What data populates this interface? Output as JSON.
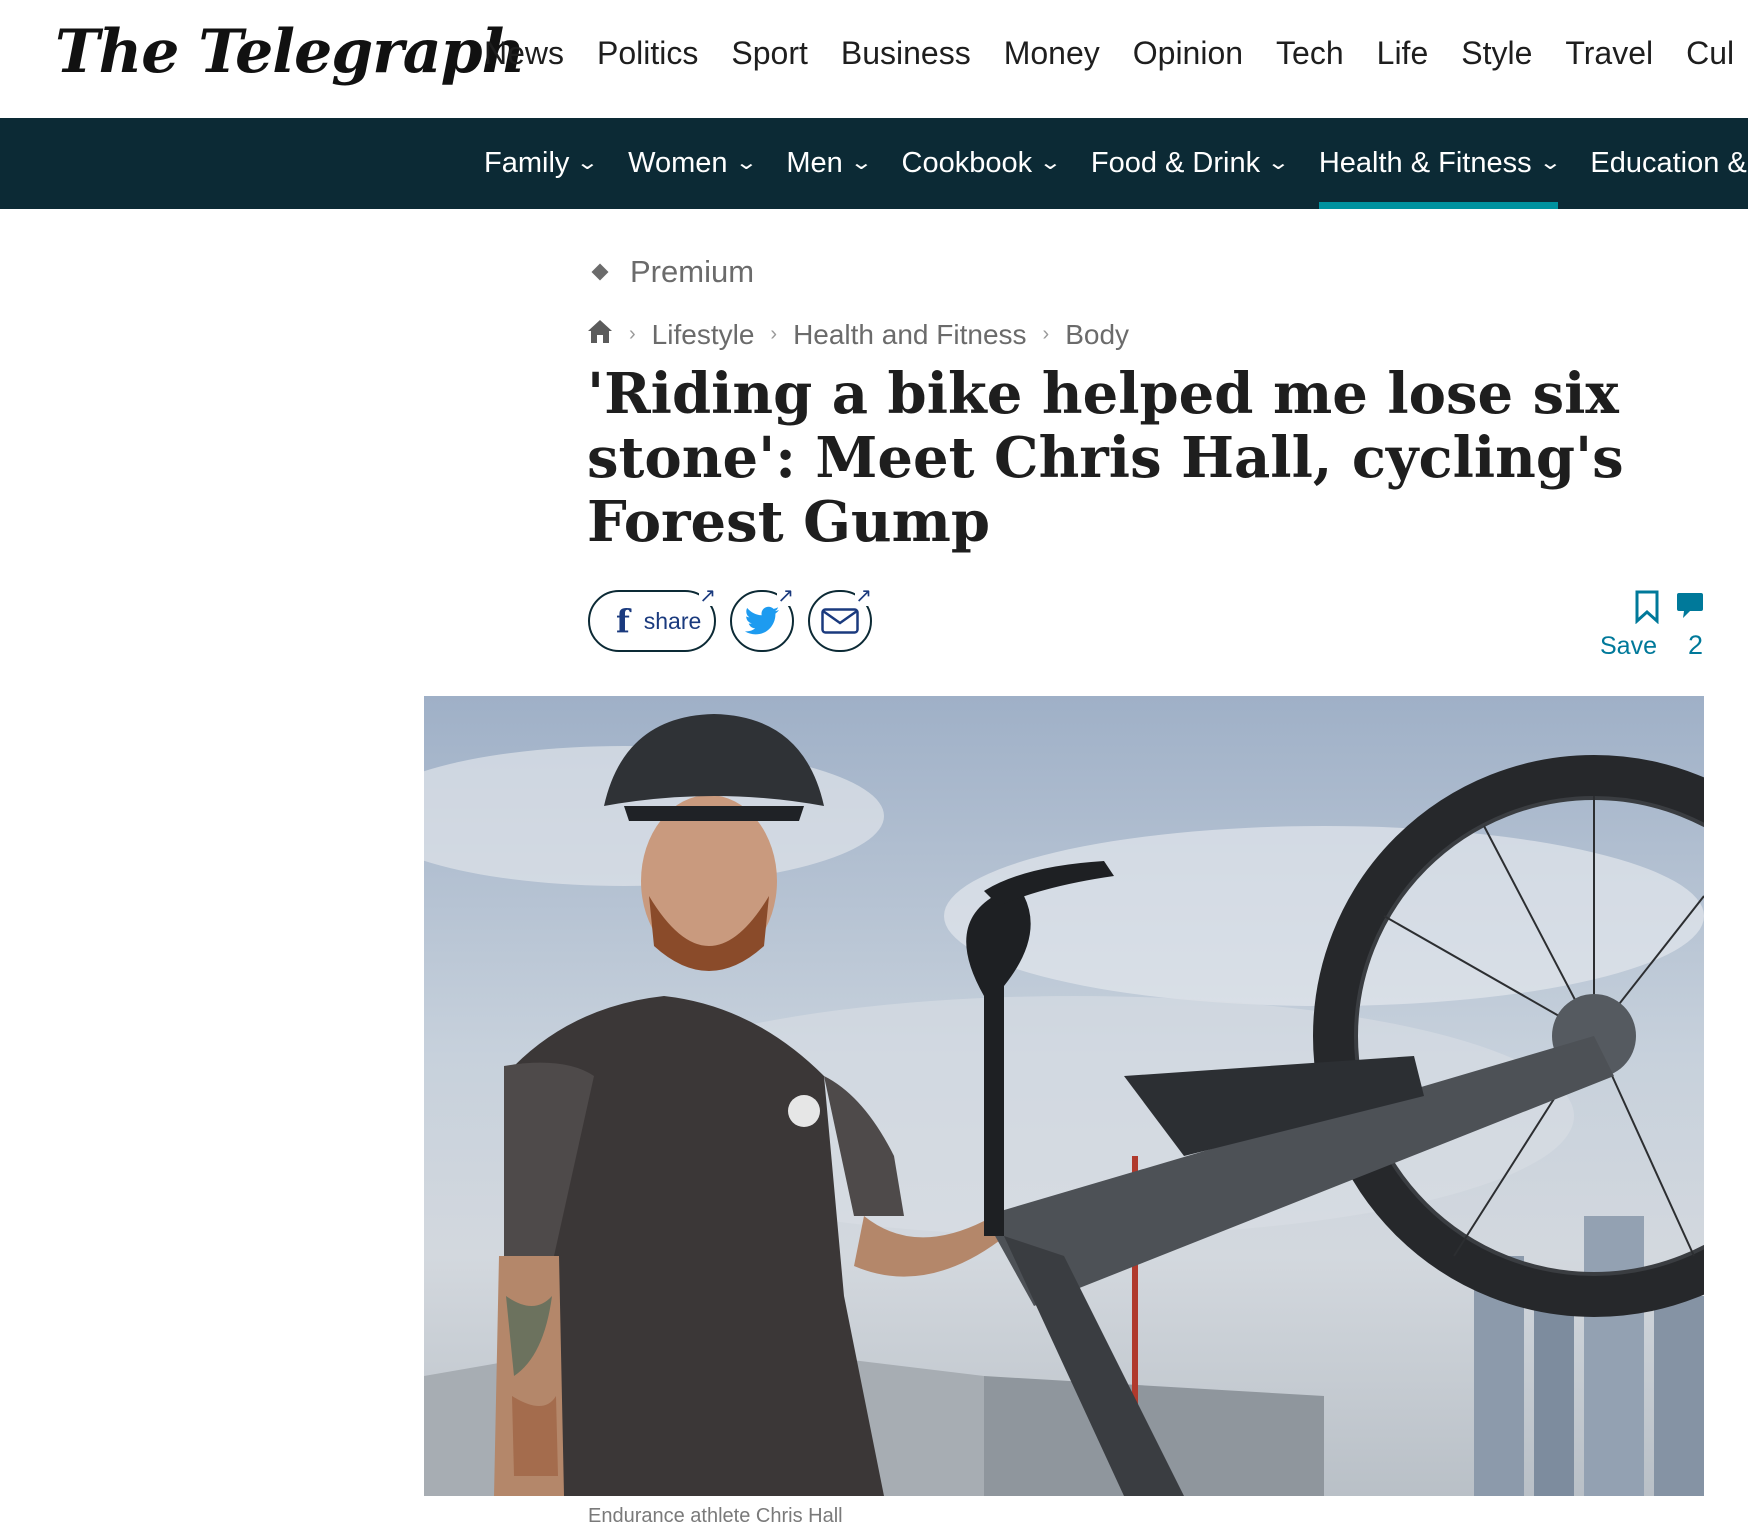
{
  "site": {
    "logo_text": "The Telegraph"
  },
  "primary_nav": [
    {
      "label": "News"
    },
    {
      "label": "Politics"
    },
    {
      "label": "Sport"
    },
    {
      "label": "Business"
    },
    {
      "label": "Money"
    },
    {
      "label": "Opinion"
    },
    {
      "label": "Tech"
    },
    {
      "label": "Life"
    },
    {
      "label": "Style"
    },
    {
      "label": "Travel"
    },
    {
      "label": "Cul"
    }
  ],
  "primary_nav_active": "Life",
  "secondary_nav": [
    {
      "label": "Family"
    },
    {
      "label": "Women"
    },
    {
      "label": "Men"
    },
    {
      "label": "Cookbook"
    },
    {
      "label": "Food & Drink"
    },
    {
      "label": "Health & Fitness"
    },
    {
      "label": "Education &"
    }
  ],
  "secondary_nav_active": "Health & Fitness",
  "article": {
    "premium_label": "Premium",
    "breadcrumb": [
      "Lifestyle",
      "Health and Fitness",
      "Body"
    ],
    "headline": "'Riding a bike helped me lose six stone': Meet Chris Hall, cycling's Forest Gump",
    "share": {
      "facebook_label": "share"
    },
    "save_label": "Save",
    "comment_count": "2",
    "caption": "Endurance athlete Chris Hall"
  },
  "colors": {
    "accent": "#00929f",
    "subnav_bg": "#0c2a35",
    "link": "#00799a"
  }
}
